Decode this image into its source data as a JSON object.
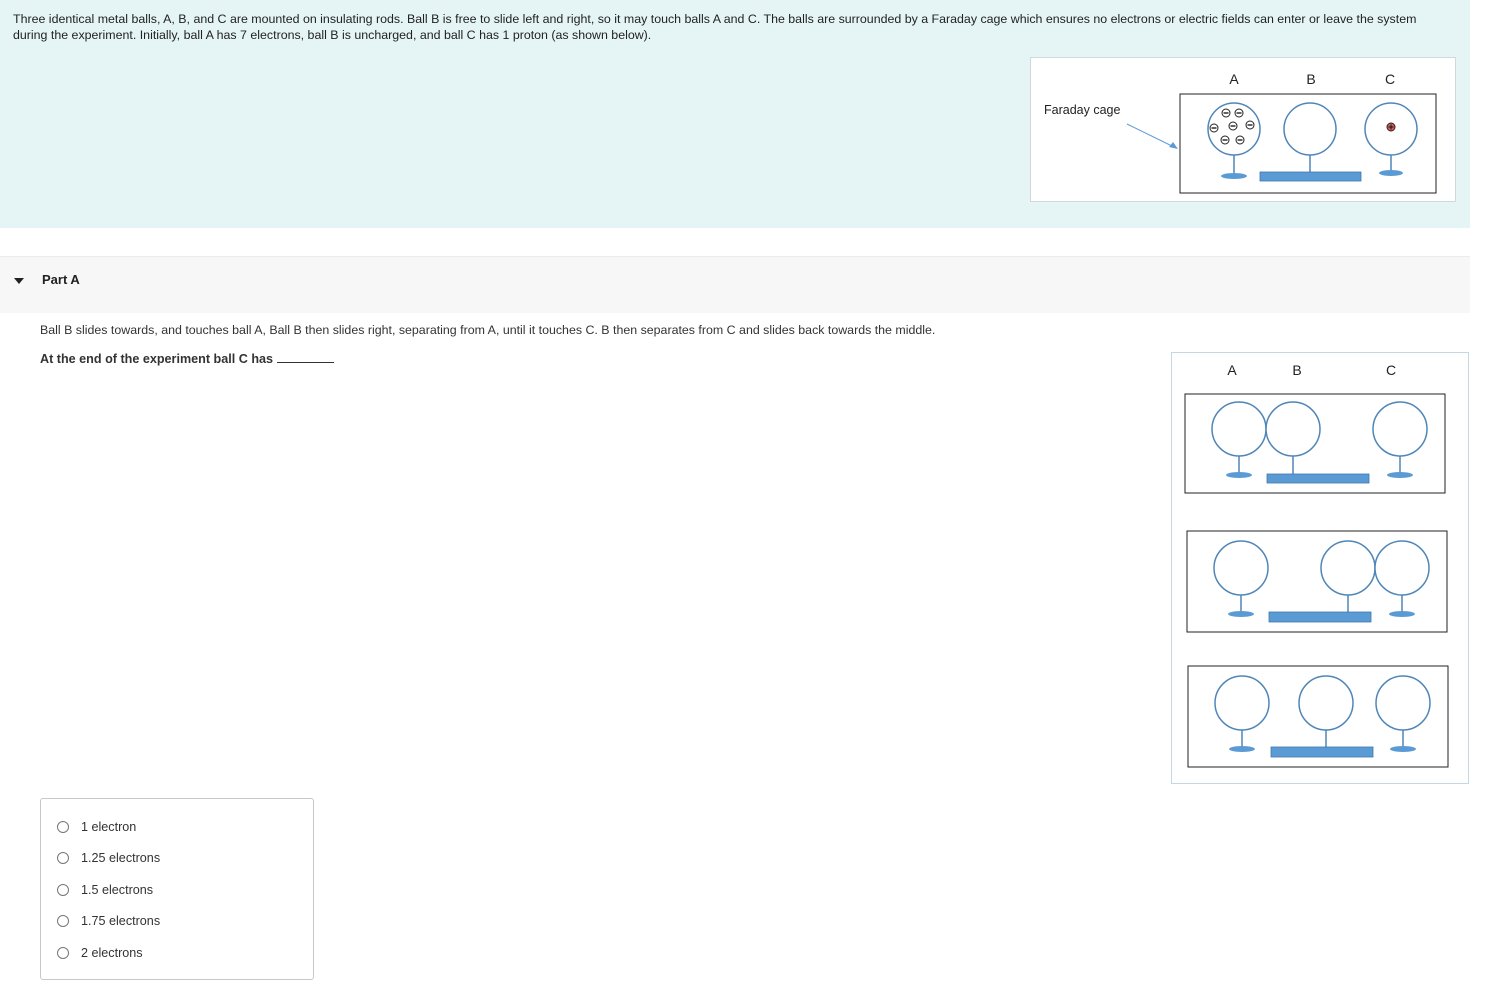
{
  "intro": {
    "text": "Three identical metal balls, A, B, and C are mounted on insulating rods. Ball B is free to slide left and right, so it may touch balls A and C. The balls are surrounded by a Faraday cage which ensures no electrons or electric fields can enter or leave the system during the experiment. Initially, ball A has 7 electrons, ball B is uncharged, and ball C has 1 proton (as shown below)."
  },
  "figure1": {
    "ball_labels": [
      "A",
      "B",
      "C"
    ],
    "cage_label": "Faraday cage",
    "electron_symbol": "⊖",
    "proton_symbol": "⊕",
    "electron_count_A": 7,
    "proton_count_C": 1
  },
  "part": {
    "label": "Part A",
    "question": "Ball B slides towards, and touches ball A, Ball B then slides right, separating from A, until it touches C. B then separates from C and slides back towards the middle.",
    "prompt": "At the end of the experiment ball C has"
  },
  "figure2": {
    "ball_labels": [
      "A",
      "B",
      "C"
    ]
  },
  "choices": [
    {
      "label": "1 electron"
    },
    {
      "label": "1.25 electrons"
    },
    {
      "label": "1.5 electrons"
    },
    {
      "label": "1.75 electrons"
    },
    {
      "label": "2 electrons"
    }
  ],
  "colors": {
    "intro_bg": "#e5f5f5",
    "ball_stroke": "#4f86b8",
    "rod_fill": "#5b9bd5",
    "proton_fill": "#e05a5a"
  }
}
